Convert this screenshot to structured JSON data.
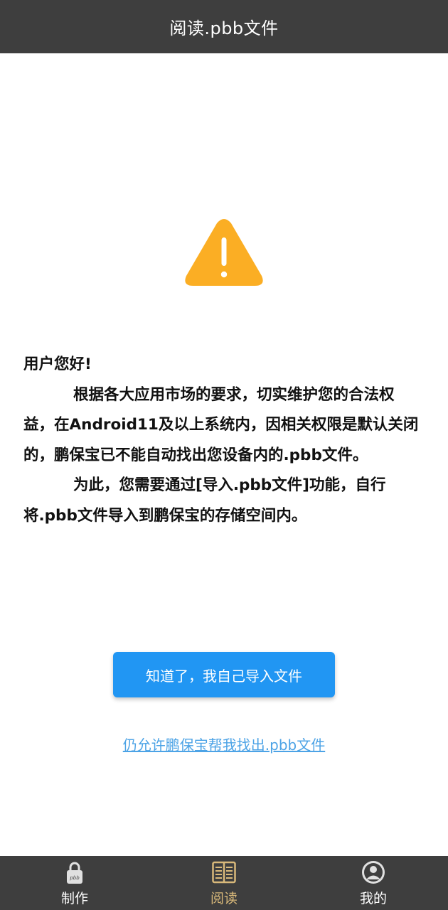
{
  "header": {
    "title": "阅读.pbb文件"
  },
  "warning": {
    "icon": "warning-triangle-icon",
    "color": "#fbae24"
  },
  "message": {
    "greeting": "用户您好!",
    "paragraph1": "根据各大应用市场的要求，切实维护您的合法权益，在Android11及以上系统内，因相关权限是默认关闭的，鹏保宝已不能自动找出您设备内的.pbb文件。",
    "paragraph2": "为此，您需要通过[导入.pbb文件]功能，自行将.pbb文件导入到鹏保宝的存储空间内。"
  },
  "actions": {
    "primary_label": "知道了，我自己导入文件",
    "secondary_label": "仍允许鹏保宝帮我找出.pbb文件"
  },
  "bottom_nav": {
    "items": [
      {
        "label": "制作",
        "icon": "lock-pbb-icon",
        "active": false
      },
      {
        "label": "阅读",
        "icon": "book-icon",
        "active": true
      },
      {
        "label": "我的",
        "icon": "user-avatar-icon",
        "active": false
      }
    ]
  },
  "colors": {
    "bar_background": "#3e3e3e",
    "primary_button": "#2196f3",
    "link": "#4ca3e6",
    "active_tab": "#d9b97a"
  }
}
